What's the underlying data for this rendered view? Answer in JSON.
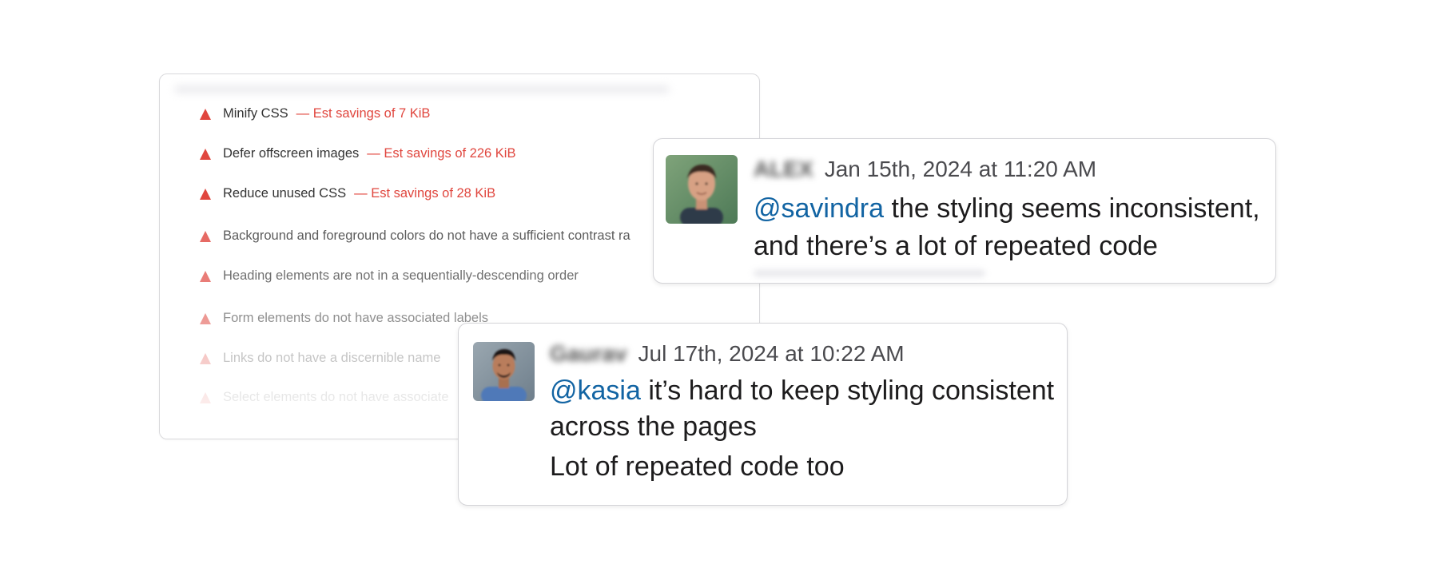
{
  "audit": {
    "items": [
      {
        "label": "Minify CSS",
        "savings": "— Est savings of 7 KiB"
      },
      {
        "label": "Defer offscreen images",
        "savings": "— Est savings of 226 KiB"
      },
      {
        "label": "Reduce unused CSS",
        "savings": "— Est savings of 28 KiB"
      },
      {
        "label": "Background and foreground colors do not have a sufficient contrast ra",
        "savings": ""
      },
      {
        "label": "Heading elements are not in a sequentially-descending order",
        "savings": ""
      },
      {
        "label": "Form elements do not have associated labels",
        "savings": ""
      },
      {
        "label": "Links do not have a discernible name",
        "savings": ""
      },
      {
        "label": "Select elements do not have associate",
        "savings": ""
      }
    ]
  },
  "messages": [
    {
      "author": "ALEX",
      "timestamp": "Jan 15th, 2024 at 11:20 AM",
      "mention": "@savindra",
      "line1_rest": " the styling seems inconsistent,",
      "line2": "and there’s a lot of repeated code"
    },
    {
      "author": "Gaurav",
      "timestamp": "Jul 17th, 2024 at 10:22 AM",
      "mention": "@kasia",
      "line1_rest": " it’s hard to keep styling consistent",
      "line2": "across the pages",
      "line3": "Lot of repeated code too"
    }
  ],
  "colors": {
    "warning": "#e0463e",
    "mention": "#1264a3",
    "text": "#1d1c1d"
  }
}
